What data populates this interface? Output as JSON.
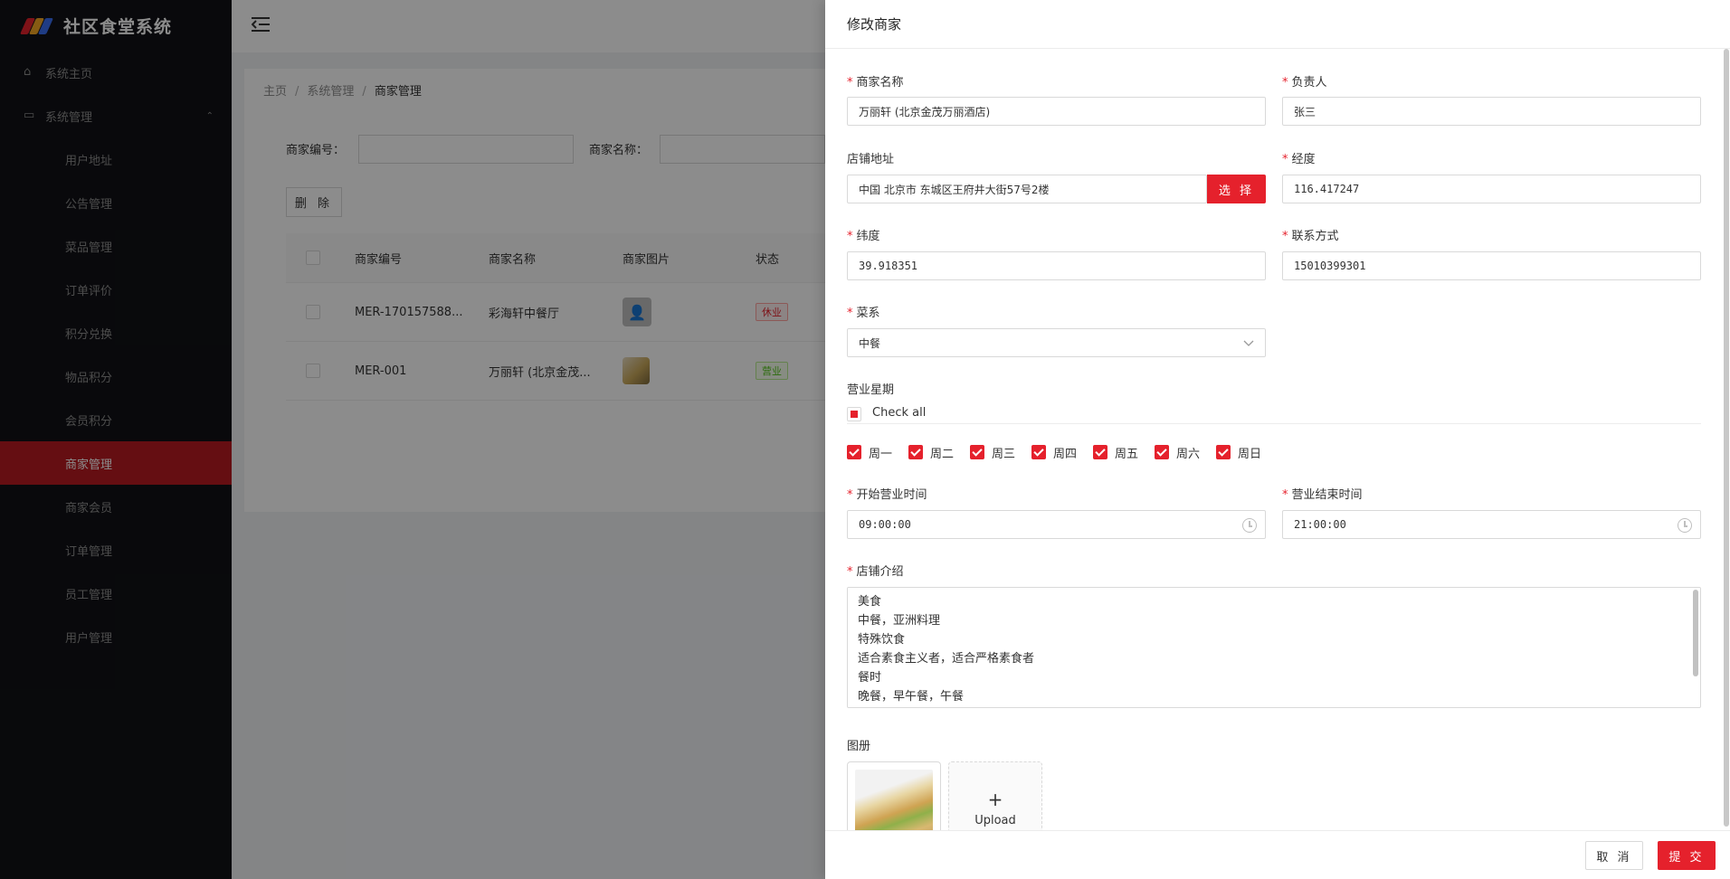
{
  "app": {
    "title": "社区食堂系统",
    "brand_colors": [
      "#e5212c",
      "#f5a623",
      "#3a6df0"
    ]
  },
  "sidebar": {
    "home": {
      "label": "系统主页",
      "icon": "home-icon"
    },
    "system": {
      "label": "系统管理",
      "icon": "monitor-icon"
    },
    "items": [
      {
        "label": "用户地址"
      },
      {
        "label": "公告管理"
      },
      {
        "label": "菜品管理"
      },
      {
        "label": "订单评价"
      },
      {
        "label": "积分兑换"
      },
      {
        "label": "物品积分"
      },
      {
        "label": "会员积分"
      },
      {
        "label": "商家管理"
      },
      {
        "label": "商家会员"
      },
      {
        "label": "订单管理"
      },
      {
        "label": "员工管理"
      },
      {
        "label": "用户管理"
      }
    ],
    "active": "商家管理"
  },
  "breadcrumb": {
    "home": "主页",
    "level1": "系统管理",
    "level2": "商家管理",
    "sep": "/"
  },
  "search": {
    "code_label": "商家编号：",
    "name_label": "商家名称："
  },
  "toolbar": {
    "delete_label": "删 除"
  },
  "table": {
    "headers": {
      "code": "商家编号",
      "name": "商家名称",
      "image": "商家图片",
      "status": "状态"
    },
    "rows": [
      {
        "code": "MER-170157588...",
        "name": "彩海轩中餐厅",
        "status": "休业"
      },
      {
        "code": "MER-001",
        "name": "万丽轩 (北京金茂...",
        "status": "营业"
      }
    ]
  },
  "drawer": {
    "title": "修改商家",
    "fields": {
      "merchant_name": {
        "label": "商家名称",
        "value": "万丽轩 (北京金茂万丽酒店)"
      },
      "owner": {
        "label": "负责人",
        "value": "张三"
      },
      "address": {
        "label": "店铺地址",
        "value": "中国 北京市 东城区王府井大街57号2楼",
        "button": "选 择"
      },
      "longitude": {
        "label": "经度",
        "value": "116.417247"
      },
      "latitude": {
        "label": "纬度",
        "value": "39.918351"
      },
      "contact": {
        "label": "联系方式",
        "value": "15010399301"
      },
      "cuisine": {
        "label": "菜系",
        "value": "中餐"
      },
      "weekdays": {
        "label": "营业星期",
        "check_all": "Check all",
        "days": [
          "周一",
          "周二",
          "周三",
          "周四",
          "周五",
          "周六",
          "周日"
        ]
      },
      "start_time": {
        "label": "开始营业时间",
        "value": "09:00:00"
      },
      "end_time": {
        "label": "营业结束时间",
        "value": "21:00:00"
      },
      "intro": {
        "label": "店铺介绍",
        "lines": [
          "美食",
          "中餐，亚洲料理",
          "特殊饮食",
          "适合素食主义者，适合严格素食者",
          "餐时",
          "晚餐，早午餐，午餐"
        ]
      },
      "gallery": {
        "label": "图册",
        "upload": "Upload"
      }
    },
    "footer": {
      "cancel": "取 消",
      "submit": "提 交"
    }
  }
}
